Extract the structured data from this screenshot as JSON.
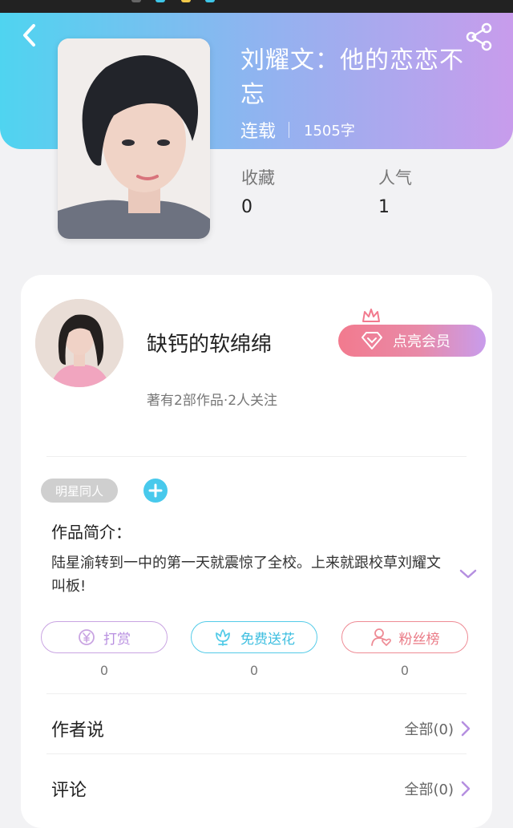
{
  "book": {
    "title": "刘耀文：他的恋恋不忘",
    "status": "连载",
    "word_count": "1505字",
    "favorites_label": "收藏",
    "favorites_value": "0",
    "popularity_label": "人气",
    "popularity_value": "1"
  },
  "author": {
    "name": "缺钙的软绵绵",
    "stats": "著有2部作品·2人关注",
    "vip_label": "点亮会员"
  },
  "tags": [
    "明星同人"
  ],
  "intro": {
    "label": "作品简介：",
    "text": "陆星渝转到一中的第一天就震惊了全校。上来就跟校草刘耀文叫板!"
  },
  "actions": [
    {
      "label": "打赏",
      "icon": "yen-coin-icon",
      "count": "0",
      "color": "#c9a4e2"
    },
    {
      "label": "免费送花",
      "icon": "flower-icon",
      "count": "0",
      "color": "#54cbe8"
    },
    {
      "label": "粉丝榜",
      "icon": "fan-user-icon",
      "count": "0",
      "color": "#ee8b95"
    }
  ],
  "author_says": {
    "title": "作者说",
    "link": "全部(0)"
  },
  "comments": {
    "title": "评论",
    "link": "全部(0)"
  },
  "colors": {
    "header_gradient": [
      "#4fd4f0",
      "#c89cec"
    ],
    "vip_gradient": [
      "#f27a8e",
      "#c89cec"
    ],
    "accent_cyan": "#48c9ec",
    "chevron_purple": "#b58fe0"
  }
}
